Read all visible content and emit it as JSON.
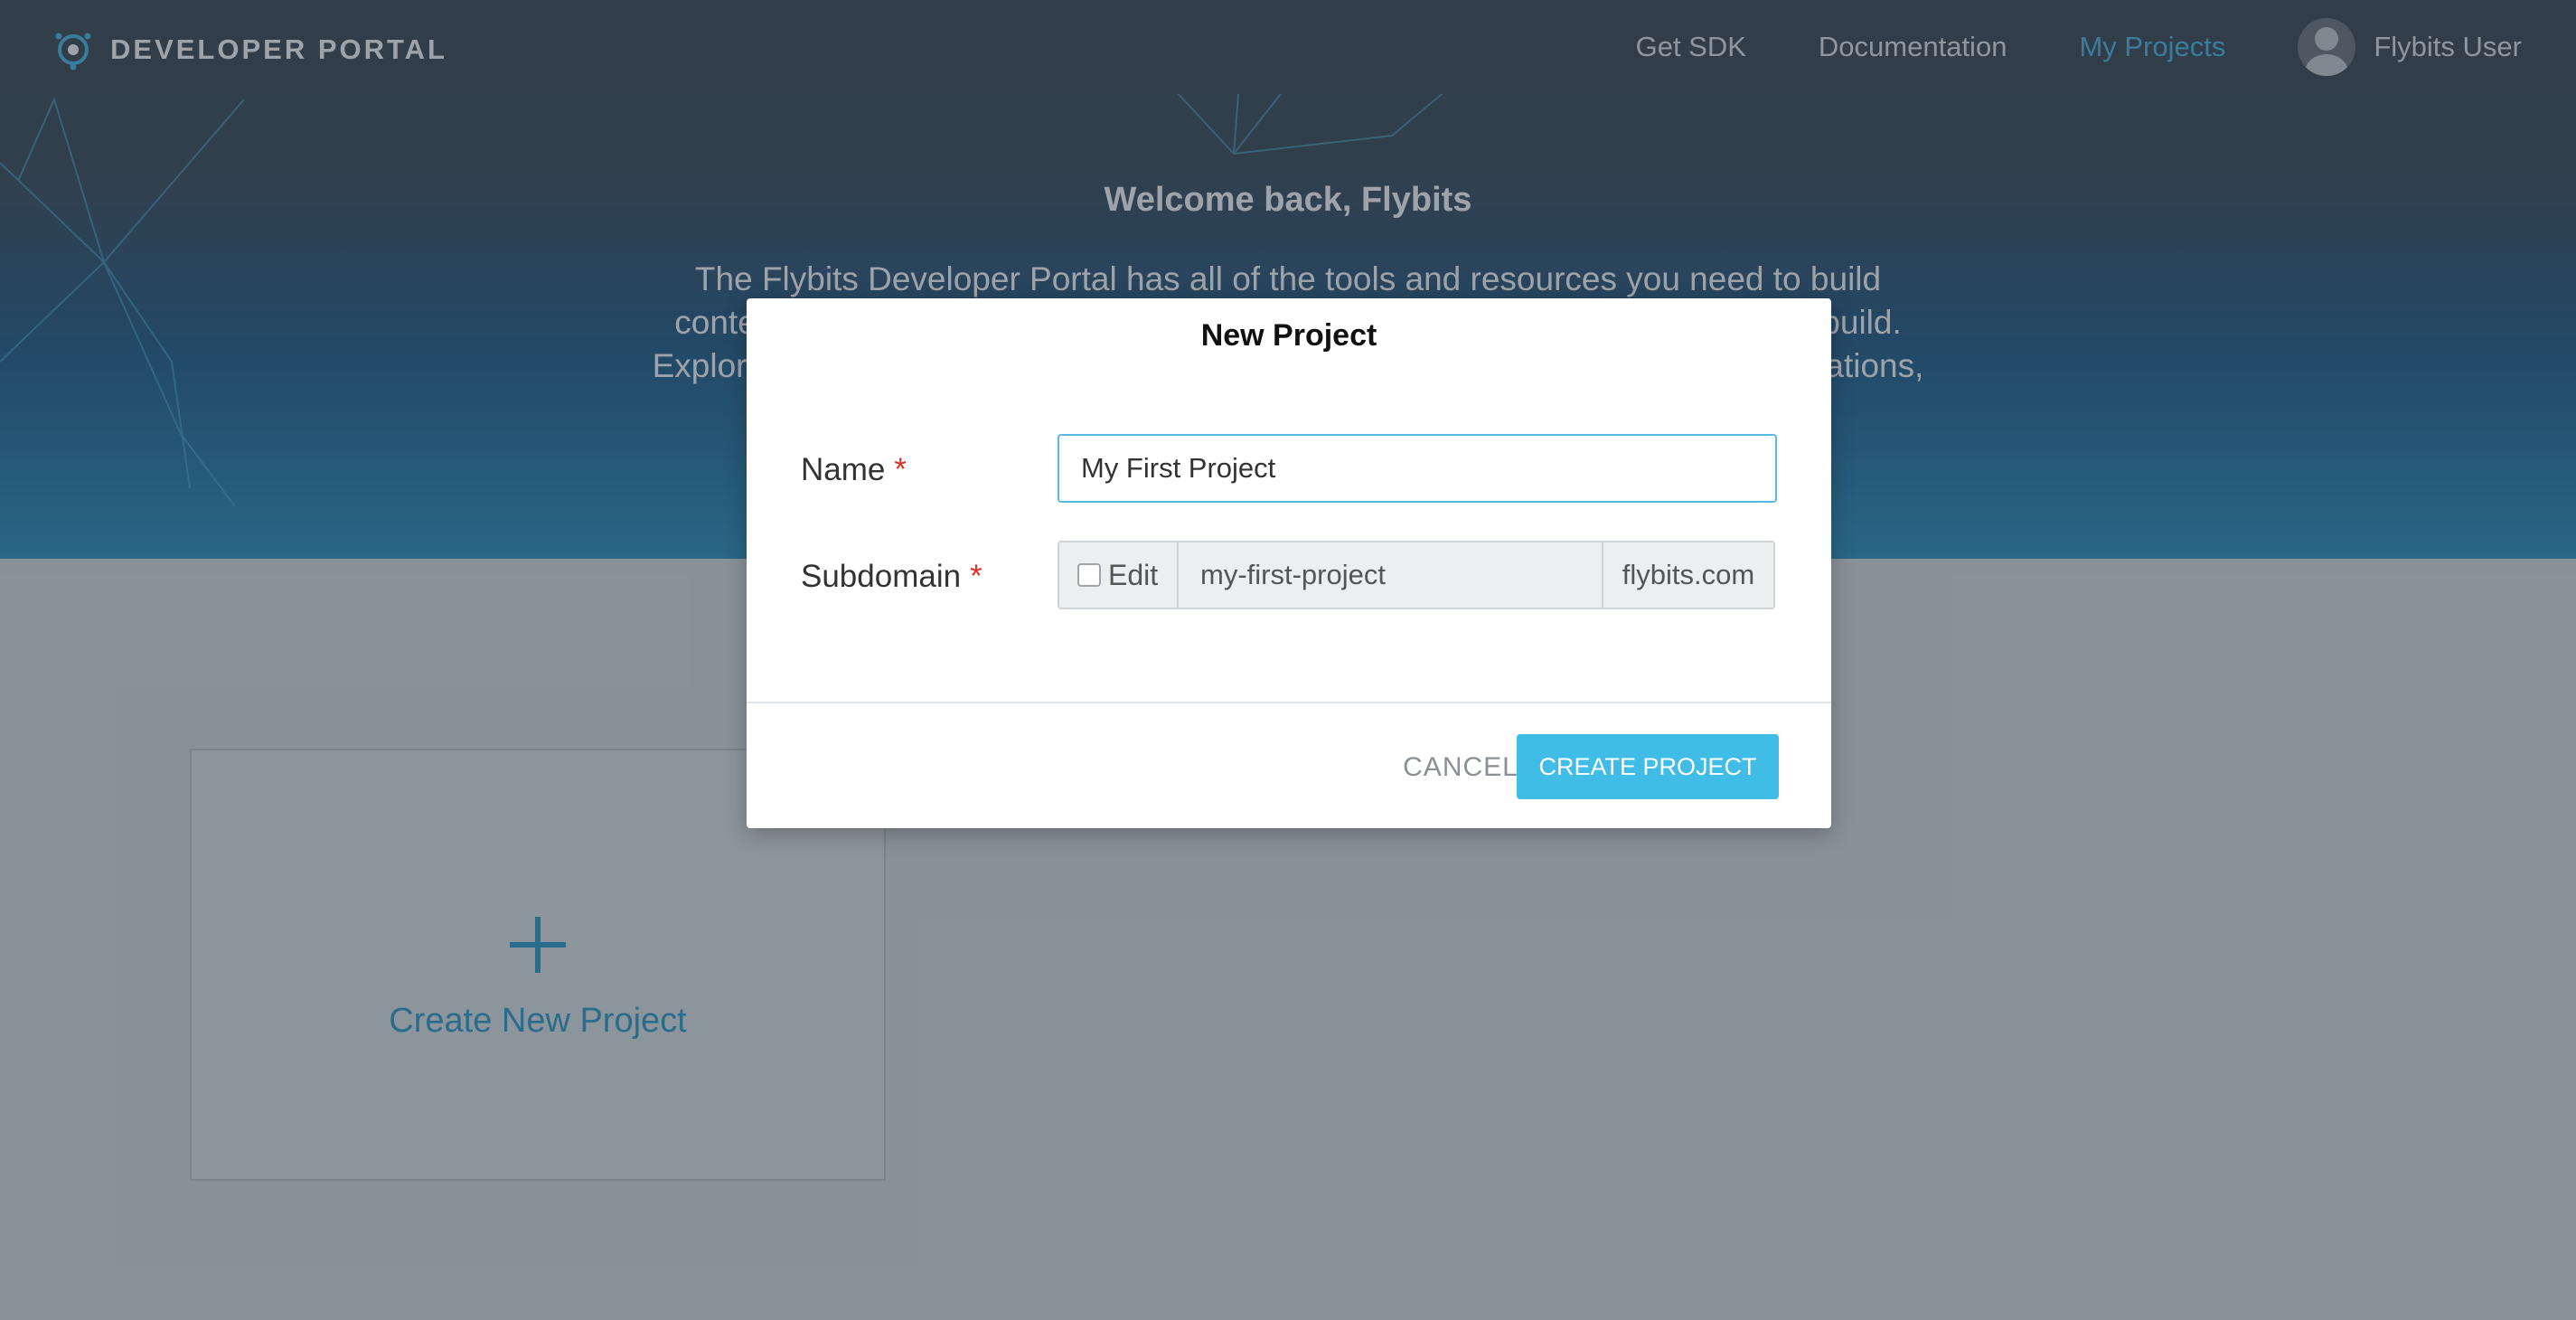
{
  "navbar": {
    "brand": "DEVELOPER PORTAL",
    "links": [
      {
        "label": "Get SDK"
      },
      {
        "label": "Documentation"
      },
      {
        "label": "My Projects",
        "active": true
      }
    ],
    "user_name": "Flybits User"
  },
  "hero": {
    "welcome": "Welcome back, Flybits",
    "intro": "The Flybits Developer Portal has all of the tools and resources you need to build contextual experiences. Create a project to get started and see what you can build. Explore our SDKs, documentation and libraries for iOS, Android and web applications,"
  },
  "projects": {
    "create_label": "Create New Project"
  },
  "modal": {
    "title": "New Project",
    "name_label": "Name",
    "required_mark": "*",
    "name_value": "My First Project",
    "subdomain_label": "Subdomain",
    "edit_label": "Edit",
    "edit_checked": false,
    "subdomain_value": "my-first-project",
    "subdomain_suffix": "flybits.com",
    "cancel_label": "CANCEL",
    "create_label": "CREATE PROJECT"
  },
  "colors": {
    "accent": "#3fbde7",
    "nav_active": "#49b8e6",
    "required": "#d9342b"
  }
}
